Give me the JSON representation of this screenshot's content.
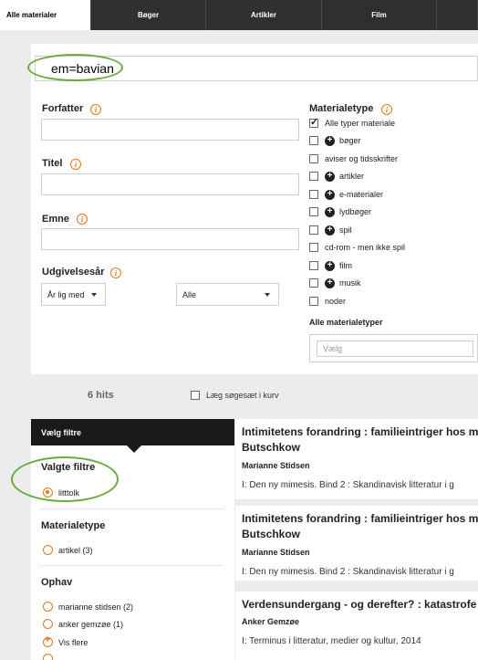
{
  "tabs": [
    {
      "label": "Alle materialer",
      "active": true
    },
    {
      "label": "Bøger",
      "active": false
    },
    {
      "label": "Artikler",
      "active": false
    },
    {
      "label": "Film",
      "active": false
    }
  ],
  "search": {
    "value": "em=bavian"
  },
  "fields": {
    "author_label": "Forfatter",
    "title_label": "Titel",
    "subject_label": "Emne",
    "year_label": "Udgivelsesår",
    "year_mode": "År lig med",
    "year_value": "Alle"
  },
  "material": {
    "label": "Materialetype",
    "items": [
      {
        "label": "Alle typer materiale",
        "checked": true,
        "expand": false
      },
      {
        "label": "bøger",
        "checked": false,
        "expand": true
      },
      {
        "label": "aviser og tidsskrifter",
        "checked": false,
        "expand": false
      },
      {
        "label": "artikler",
        "checked": false,
        "expand": true
      },
      {
        "label": "e-materialer",
        "checked": false,
        "expand": true
      },
      {
        "label": "lydbøger",
        "checked": false,
        "expand": true
      },
      {
        "label": "spil",
        "checked": false,
        "expand": true
      },
      {
        "label": "cd-rom - men ikke spil",
        "checked": false,
        "expand": false
      },
      {
        "label": "film",
        "checked": false,
        "expand": true
      },
      {
        "label": "musik",
        "checked": false,
        "expand": true
      },
      {
        "label": "noder",
        "checked": false,
        "expand": false
      }
    ],
    "all_types_label": "Alle materialetyper",
    "select_placeholder": "Vælg"
  },
  "results_bar": {
    "hits": "6 hits",
    "basket_label": "Læg søgesæt i kurv"
  },
  "filters": {
    "header": "Vælg filtre",
    "selected_heading": "Valgte filtre",
    "selected_item": "litttolk",
    "materialtype_heading": "Materialetype",
    "materialtype_item": "artikel (3)",
    "ophav_heading": "Ophav",
    "ophav_items": [
      "marianne stidsen (2)",
      "anker gemzøe (1)"
    ],
    "more_label": "Vis flere"
  },
  "results": [
    {
      "title": "Intimitetens forandring : familieintriger hos m Butschkow",
      "author": "Marianne Stidsen",
      "source": "I: Den ny mimesis. Bind 2 : Skandinavisk litteratur i g"
    },
    {
      "title": "Intimitetens forandring : familieintriger hos m Butschkow",
      "author": "Marianne Stidsen",
      "source": "I: Den ny mimesis. Bind 2 : Skandinavisk litteratur i g"
    },
    {
      "title": "Verdensundergang - og derefter? : katastrofe",
      "author": "Anker Gemzøe",
      "source": "I: Terminus i litteratur, medier og kultur, 2014"
    }
  ],
  "colors": {
    "accent": "#e8761c",
    "highlight": "#6aac3c",
    "tabbar": "#2f2f2f"
  }
}
